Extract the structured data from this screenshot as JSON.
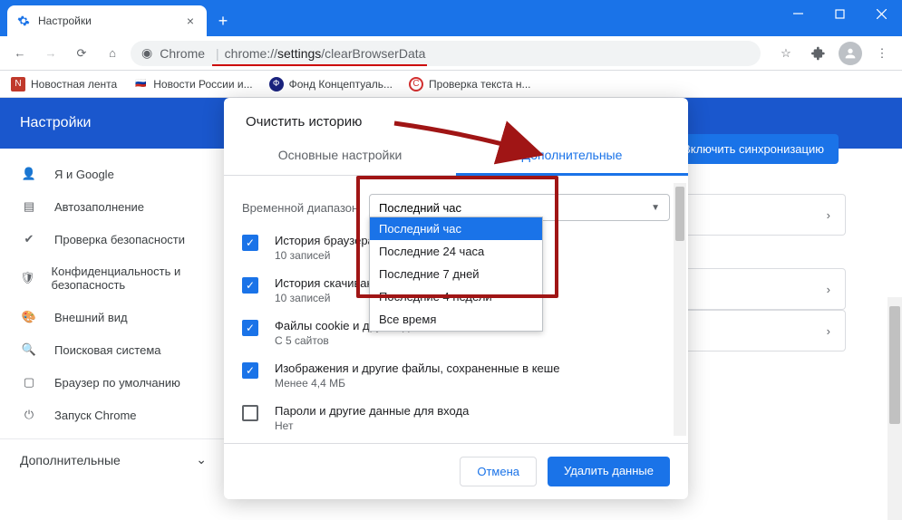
{
  "window": {
    "tab_title": "Настройки"
  },
  "toolbar": {
    "chrome_label": "Chrome",
    "url_host": "chrome://",
    "url_path1": "settings",
    "url_path2": "/clearBrowserData"
  },
  "bookmarks": [
    {
      "label": "Новостная лента"
    },
    {
      "label": "Новости России и..."
    },
    {
      "label": "Фонд Концептуаль..."
    },
    {
      "label": "Проверка текста н..."
    }
  ],
  "settings": {
    "header": "Настройки",
    "sidebar": [
      {
        "label": "Я и Google",
        "icon": "person"
      },
      {
        "label": "Автозаполнение",
        "icon": "autofill"
      },
      {
        "label": "Проверка безопасности",
        "icon": "shield-check"
      },
      {
        "label": "Конфиденциальность и безопасность",
        "icon": "shield"
      },
      {
        "label": "Внешний вид",
        "icon": "palette"
      },
      {
        "label": "Поисковая система",
        "icon": "search"
      },
      {
        "label": "Браузер по умолчанию",
        "icon": "window"
      },
      {
        "label": "Запуск Chrome",
        "icon": "power"
      }
    ],
    "sidebar_footer": "Дополнительные",
    "sync_button": "Включить синхронизацию"
  },
  "modal": {
    "title": "Очистить историю",
    "tabs": {
      "basic": "Основные настройки",
      "advanced": "Дополнительные"
    },
    "time_label": "Временной диапазон",
    "time_selected": "Последний час",
    "time_options": [
      "Последний час",
      "Последние 24 часа",
      "Последние 7 дней",
      "Последние 4 недели",
      "Все время"
    ],
    "items": [
      {
        "title": "История браузера",
        "sub": "10 записей",
        "checked": true
      },
      {
        "title": "История скачиваний",
        "sub": "10 записей",
        "checked": true
      },
      {
        "title": "Файлы cookie и другие данные сайтов",
        "sub": "С 5 сайтов",
        "checked": true
      },
      {
        "title": "Изображения и другие файлы, сохраненные в кеше",
        "sub": "Менее 4,4 МБ",
        "checked": true
      },
      {
        "title": "Пароли и другие данные для входа",
        "sub": "Нет",
        "checked": false
      }
    ],
    "cancel": "Отмена",
    "confirm": "Удалить данные"
  }
}
